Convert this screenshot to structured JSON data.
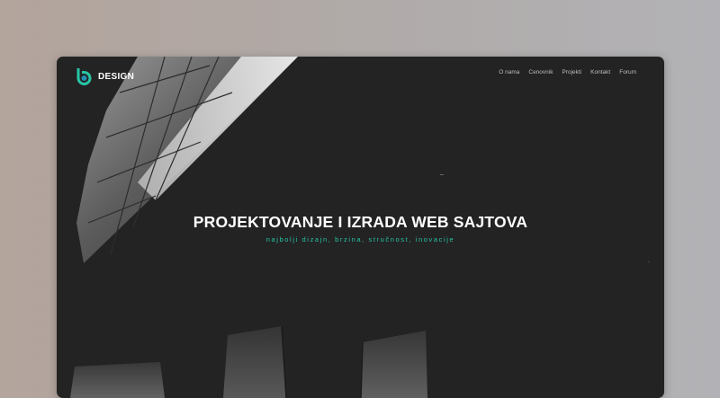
{
  "brand": {
    "name": "DESIGN",
    "accent": "#27c5a6"
  },
  "nav": {
    "items": [
      {
        "label": "O nama"
      },
      {
        "label": "Cenovnik"
      },
      {
        "label": "Projekti"
      },
      {
        "label": "Kontakt"
      },
      {
        "label": "Forum"
      }
    ]
  },
  "hero": {
    "title": "PROJEKTOVANJE I IZRADA WEB SAJTOVA",
    "subtitle": "najbolji dizajn, brzina, stručnost, inovacije"
  },
  "icons": {
    "logo": "logo-mark-icon"
  }
}
